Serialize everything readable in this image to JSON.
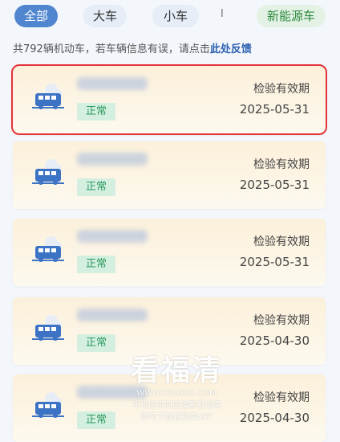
{
  "tabs": [
    {
      "label": "全部",
      "active": true
    },
    {
      "label": "大车",
      "active": false
    },
    {
      "label": "小车",
      "active": false
    },
    {
      "label": "新能源车",
      "active": false
    }
  ],
  "tab_separator": "I",
  "notice": {
    "prefix": "共792辆机动车，若车辆信息有误，请点击",
    "link": "此处反馈"
  },
  "vehicles": [
    {
      "status": "正常",
      "label": "检验有效期",
      "date": "2025-05-31",
      "selected": true
    },
    {
      "status": "正常",
      "label": "检验有效期",
      "date": "2025-05-31",
      "selected": false
    },
    {
      "status": "正常",
      "label": "检验有效期",
      "date": "2025-05-31",
      "selected": false
    },
    {
      "status": "正常",
      "label": "检验有效期",
      "date": "2025-04-30",
      "selected": false
    },
    {
      "status": "正常",
      "label": "检验有效期",
      "date": "2025-04-30",
      "selected": false
    }
  ],
  "watermark": {
    "title": "看福清",
    "url": "WWW.FQLOOK.COM",
    "line1": "手机应用商店搜索看福清",
    "line2": "即可下载看福清APP"
  },
  "colors": {
    "accent": "#4f86cf",
    "energy": "#2f8a3f",
    "highlight": "#e4333a",
    "badge": "#2c9a5f"
  }
}
